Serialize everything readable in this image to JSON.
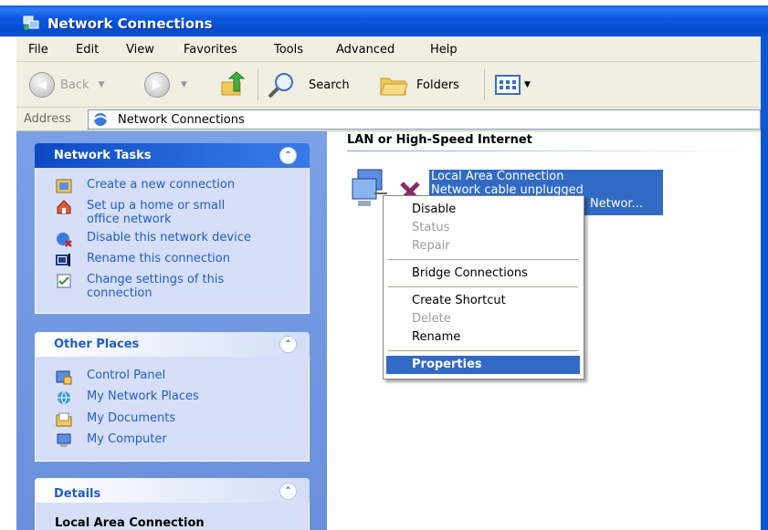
{
  "window": {
    "title": "Network Connections"
  },
  "menu": [
    "File",
    "Edit",
    "View",
    "Favorites",
    "Tools",
    "Advanced",
    "Help"
  ],
  "toolbar": {
    "back_label": "Back",
    "search_label": "Search",
    "folders_label": "Folders"
  },
  "address": {
    "label": "Address",
    "value": "Network Connections"
  },
  "network_tasks": {
    "title": "Network Tasks",
    "items": [
      {
        "label": "Create a new connection",
        "icon": "new-connection-icon"
      },
      {
        "label": "Set up a home or small office network",
        "icon": "home-network-icon"
      },
      {
        "label": "Disable this network device",
        "icon": "disable-device-icon"
      },
      {
        "label": "Rename this connection",
        "icon": "rename-icon"
      },
      {
        "label": "Change settings of this connection",
        "icon": "settings-icon"
      }
    ]
  },
  "other_places": {
    "title": "Other Places",
    "items": [
      {
        "label": "Control Panel",
        "icon": "control-panel-icon"
      },
      {
        "label": "My Network Places",
        "icon": "network-places-icon"
      },
      {
        "label": "My Documents",
        "icon": "documents-folder-icon"
      },
      {
        "label": "My Computer",
        "icon": "computer-icon"
      }
    ]
  },
  "details": {
    "title": "Details",
    "subtitle": "Local Area Connection"
  },
  "content": {
    "group_header": "LAN or High-Speed Internet",
    "connection": {
      "name": "Local Area Connection",
      "status": "Network cable unplugged",
      "device": "Networ..."
    }
  },
  "context_menu": {
    "items": [
      {
        "label": "Disable",
        "enabled": true
      },
      {
        "label": "Status",
        "enabled": false
      },
      {
        "label": "Repair",
        "enabled": false
      },
      {
        "label": "Bridge Connections",
        "enabled": true
      },
      {
        "label": "Create Shortcut",
        "enabled": true
      },
      {
        "label": "Delete",
        "enabled": false
      },
      {
        "label": "Rename",
        "enabled": true
      },
      {
        "label": "Properties",
        "enabled": true,
        "selected": true
      }
    ]
  },
  "colors": {
    "titlebar": "#0b58e0",
    "task_pane": "#6a8fdc",
    "link": "#215dc6",
    "selection": "#316ac5"
  }
}
